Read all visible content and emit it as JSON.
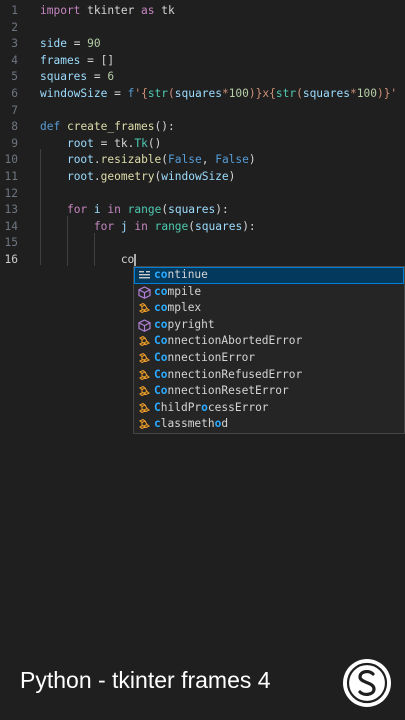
{
  "editor": {
    "active_line": "16",
    "lines": [
      {
        "n": "1",
        "tokens": [
          [
            "kw",
            "import"
          ],
          [
            "pl",
            " tkinter "
          ],
          [
            "kw",
            "as"
          ],
          [
            "pl",
            " tk"
          ]
        ]
      },
      {
        "n": "2",
        "tokens": []
      },
      {
        "n": "3",
        "tokens": [
          [
            "var",
            "side"
          ],
          [
            "op",
            " = "
          ],
          [
            "num",
            "90"
          ]
        ]
      },
      {
        "n": "4",
        "tokens": [
          [
            "var",
            "frames"
          ],
          [
            "op",
            " = "
          ],
          [
            "pl",
            "[]"
          ]
        ]
      },
      {
        "n": "5",
        "tokens": [
          [
            "var",
            "squares"
          ],
          [
            "op",
            " = "
          ],
          [
            "num",
            "6"
          ]
        ]
      },
      {
        "n": "6",
        "tokens": [
          [
            "var",
            "windowSize"
          ],
          [
            "op",
            " = "
          ],
          [
            "kw2",
            "f"
          ],
          [
            "str",
            "'{"
          ],
          [
            "cls",
            "str"
          ],
          [
            "str",
            "("
          ],
          [
            "var",
            "squares"
          ],
          [
            "str",
            "*"
          ],
          [
            "num",
            "100"
          ],
          [
            "str",
            ")}x{"
          ],
          [
            "cls",
            "str"
          ],
          [
            "str",
            "("
          ],
          [
            "var",
            "squares"
          ],
          [
            "str",
            "*"
          ],
          [
            "num",
            "100"
          ],
          [
            "str",
            ")}'"
          ]
        ]
      },
      {
        "n": "7",
        "tokens": []
      },
      {
        "n": "8",
        "tokens": [
          [
            "kw2",
            "def"
          ],
          [
            "pl",
            " "
          ],
          [
            "fn",
            "create_frames"
          ],
          [
            "pl",
            "():"
          ]
        ]
      },
      {
        "n": "9",
        "tokens": [
          [
            "pl",
            "    "
          ],
          [
            "var",
            "root"
          ],
          [
            "op",
            " = "
          ],
          [
            "pl",
            "tk."
          ],
          [
            "cls",
            "Tk"
          ],
          [
            "pl",
            "()"
          ]
        ]
      },
      {
        "n": "10",
        "tokens": [
          [
            "pl",
            "    "
          ],
          [
            "var",
            "root"
          ],
          [
            "pl",
            "."
          ],
          [
            "fn",
            "resizable"
          ],
          [
            "pl",
            "("
          ],
          [
            "kw2",
            "False"
          ],
          [
            "pl",
            ", "
          ],
          [
            "kw2",
            "False"
          ],
          [
            "pl",
            ")"
          ]
        ]
      },
      {
        "n": "11",
        "tokens": [
          [
            "pl",
            "    "
          ],
          [
            "var",
            "root"
          ],
          [
            "pl",
            "."
          ],
          [
            "fn",
            "geometry"
          ],
          [
            "pl",
            "("
          ],
          [
            "var",
            "windowSize"
          ],
          [
            "pl",
            ")"
          ]
        ]
      },
      {
        "n": "12",
        "tokens": []
      },
      {
        "n": "13",
        "tokens": [
          [
            "pl",
            "    "
          ],
          [
            "kw",
            "for"
          ],
          [
            "pl",
            " "
          ],
          [
            "var",
            "i"
          ],
          [
            "pl",
            " "
          ],
          [
            "kw",
            "in"
          ],
          [
            "pl",
            " "
          ],
          [
            "cls",
            "range"
          ],
          [
            "pl",
            "("
          ],
          [
            "var",
            "squares"
          ],
          [
            "pl",
            "):"
          ]
        ]
      },
      {
        "n": "14",
        "tokens": [
          [
            "pl",
            "        "
          ],
          [
            "kw",
            "for"
          ],
          [
            "pl",
            " "
          ],
          [
            "var",
            "j"
          ],
          [
            "pl",
            " "
          ],
          [
            "kw",
            "in"
          ],
          [
            "pl",
            " "
          ],
          [
            "cls",
            "range"
          ],
          [
            "pl",
            "("
          ],
          [
            "var",
            "squares"
          ],
          [
            "pl",
            "):"
          ]
        ]
      },
      {
        "n": "15",
        "tokens": []
      },
      {
        "n": "16",
        "tokens": [
          [
            "pl",
            "            co"
          ]
        ]
      }
    ]
  },
  "suggestions": [
    {
      "icon": "keyword-icon",
      "match": "co",
      "rest": "ntinue",
      "selected": true
    },
    {
      "icon": "cube-icon",
      "match": "co",
      "rest": "mpile",
      "selected": false
    },
    {
      "icon": "class-icon",
      "match": "co",
      "rest": "mplex",
      "selected": false
    },
    {
      "icon": "cube-icon",
      "match": "co",
      "rest": "pyright",
      "selected": false
    },
    {
      "icon": "class-icon",
      "match": "Co",
      "rest": "nnectionAbortedError",
      "selected": false
    },
    {
      "icon": "class-icon",
      "match": "Co",
      "rest": "nnectionError",
      "selected": false
    },
    {
      "icon": "class-icon",
      "match": "Co",
      "rest": "nnectionRefusedError",
      "selected": false
    },
    {
      "icon": "class-icon",
      "match": "Co",
      "rest": "nnectionResetError",
      "selected": false
    },
    {
      "icon": "class-icon",
      "parts": [
        [
          "C",
          true
        ],
        [
          "hildPr",
          false
        ],
        [
          "o",
          true
        ],
        [
          "cessError",
          false
        ]
      ],
      "selected": false
    },
    {
      "icon": "class-icon",
      "parts": [
        [
          "c",
          true
        ],
        [
          "lassmeth",
          false
        ],
        [
          "o",
          true
        ],
        [
          "d",
          false
        ]
      ],
      "selected": false
    }
  ],
  "footer": {
    "title": "Python - tkinter frames 4",
    "logo_icon": "s-logo-icon"
  },
  "colors": {
    "background": "#1f1f1f",
    "selection": "#04395e",
    "match": "#2aaaff"
  }
}
